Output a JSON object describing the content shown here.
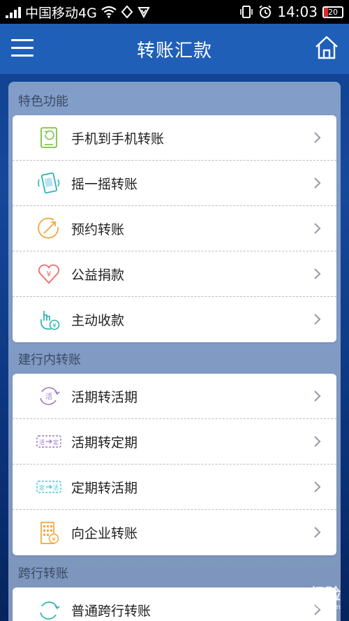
{
  "status_bar": {
    "carrier": "中国移动4G",
    "time": "14:03",
    "battery": "20"
  },
  "header": {
    "title": "转账汇款"
  },
  "sections": [
    {
      "title": "特色功能",
      "items": [
        {
          "label": "手机到手机转账",
          "icon": "phone-transfer-icon"
        },
        {
          "label": "摇一摇转账",
          "icon": "shake-phone-icon"
        },
        {
          "label": "预约转账",
          "icon": "scheduled-arrow-icon"
        },
        {
          "label": "公益捐款",
          "icon": "heart-yuan-icon"
        },
        {
          "label": "主动收款",
          "icon": "hand-tap-yuan-icon"
        }
      ]
    },
    {
      "title": "建行内转账",
      "items": [
        {
          "label": "活期转活期",
          "icon": "current-cycle-icon"
        },
        {
          "label": "活期转定期",
          "icon": "current-to-fixed-icon"
        },
        {
          "label": "定期转活期",
          "icon": "fixed-to-current-icon"
        },
        {
          "label": "向企业转账",
          "icon": "building-yuan-icon"
        }
      ]
    },
    {
      "title": "跨行转账",
      "items": [
        {
          "label": "普通跨行转账",
          "icon": "interbank-cycle-icon"
        }
      ]
    }
  ],
  "icon_glyphs": {
    "yuan": "¥",
    "huo": "活",
    "ding": "定"
  },
  "watermark": {
    "brand": "Bai 经验",
    "url": "jingyan.baidu.com"
  },
  "colors": {
    "header": "#1f5fb8",
    "icon_green": "#7cc242",
    "icon_teal": "#2bb5b0",
    "icon_orange": "#f3a43a",
    "icon_red": "#ee6b6b",
    "icon_purple": "#9a79c8",
    "icon_cyan": "#45c0e0"
  }
}
